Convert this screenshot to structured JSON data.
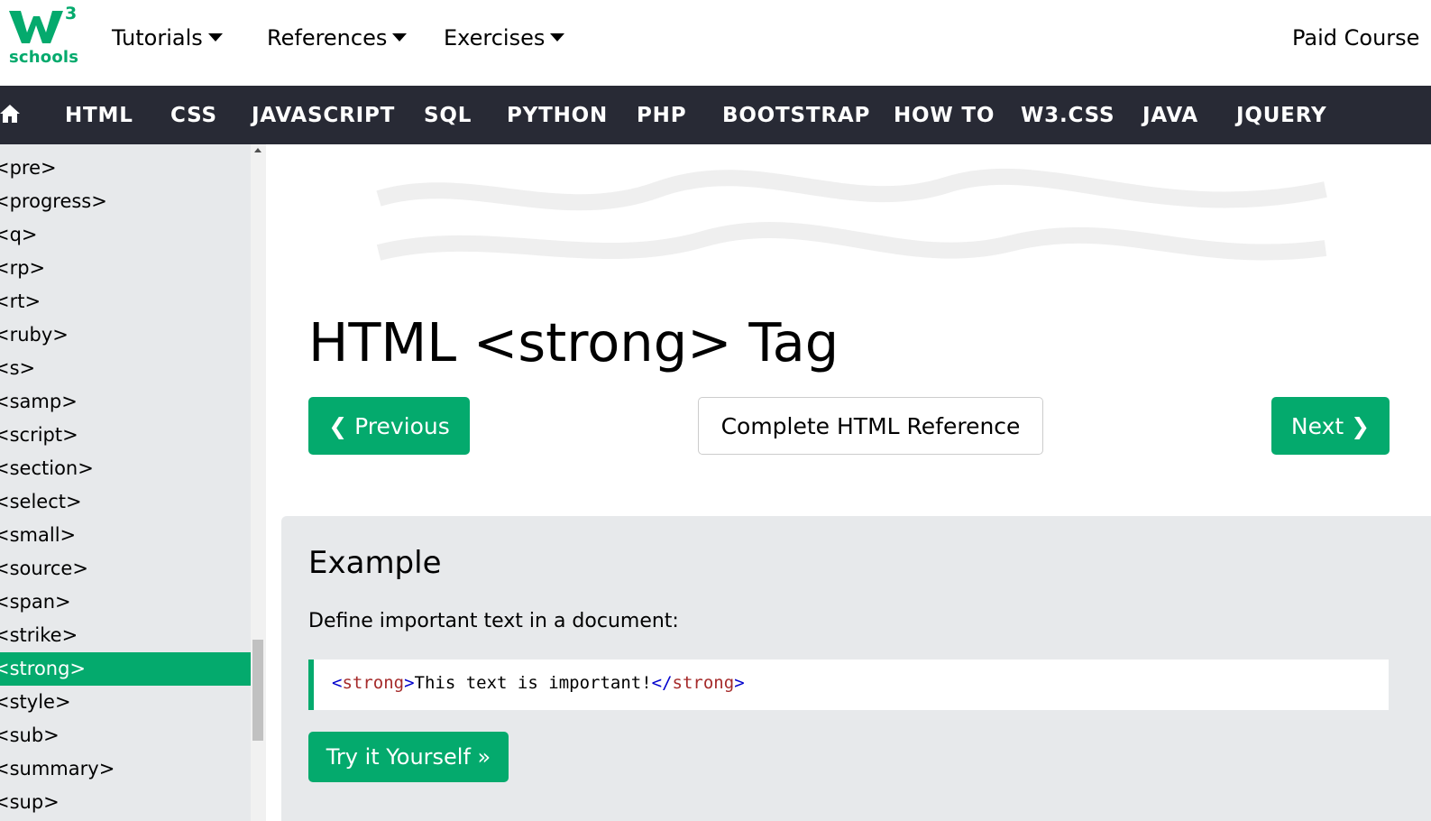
{
  "brand": {
    "name": "schools",
    "superscript": "3",
    "primary_color": "#04AA6D"
  },
  "top_menu": [
    {
      "label": "Tutorials"
    },
    {
      "label": "References"
    },
    {
      "label": "Exercises"
    }
  ],
  "paid_courses_label": "Paid Course",
  "main_nav": {
    "bg_color": "#282A35",
    "items": [
      "HTML",
      "CSS",
      "JAVASCRIPT",
      "SQL",
      "PYTHON",
      "PHP",
      "BOOTSTRAP",
      "HOW TO",
      "W3.CSS",
      "JAVA",
      "JQUERY"
    ]
  },
  "sidebar": {
    "items": [
      "<pre>",
      "<progress>",
      "<q>",
      "<rp>",
      "<rt>",
      "<ruby>",
      "<s>",
      "<samp>",
      "<script>",
      "<section>",
      "<select>",
      "<small>",
      "<source>",
      "<span>",
      "<strike>",
      "<strong>",
      "<style>",
      "<sub>",
      "<summary>",
      "<sup>"
    ],
    "active": "<strong>"
  },
  "page": {
    "title": "HTML <strong> Tag",
    "prev_label": "❮ Previous",
    "reference_label": "Complete HTML Reference",
    "next_label": "Next ❯"
  },
  "example": {
    "heading": "Example",
    "description": "Define important text in a document:",
    "code": {
      "open_bracket": "<",
      "tag_name": "strong",
      "close_bracket": ">",
      "content": "This text is important!",
      "end_open": "</",
      "end_tag_name": "strong",
      "end_close": ">"
    },
    "try_label": "Try it Yourself »"
  }
}
